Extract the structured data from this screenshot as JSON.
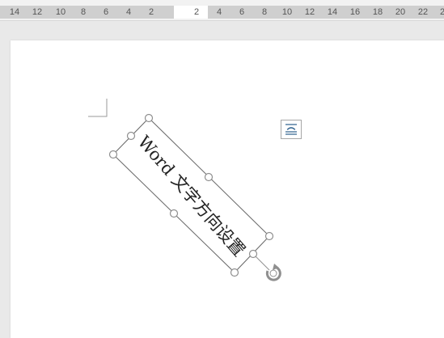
{
  "ruler": {
    "left_numbers": [
      "14",
      "12",
      "10",
      "8",
      "6",
      "4",
      "2"
    ],
    "right_numbers": [
      "2",
      "4",
      "6",
      "8",
      "10",
      "12",
      "14",
      "16",
      "18",
      "20",
      "22",
      "2"
    ]
  },
  "textbox": {
    "text": "Word 文字方向设置"
  },
  "icons": {
    "layout_options": "layout-options-icon",
    "rotate_handle": "rotate-handle-icon",
    "margin_corner": "page-margin-corner-icon"
  },
  "colors": {
    "handle_stroke": "#8f8f8f",
    "ruler_band": "#cfcfcf",
    "layout_icon": "#2c5f8c"
  }
}
